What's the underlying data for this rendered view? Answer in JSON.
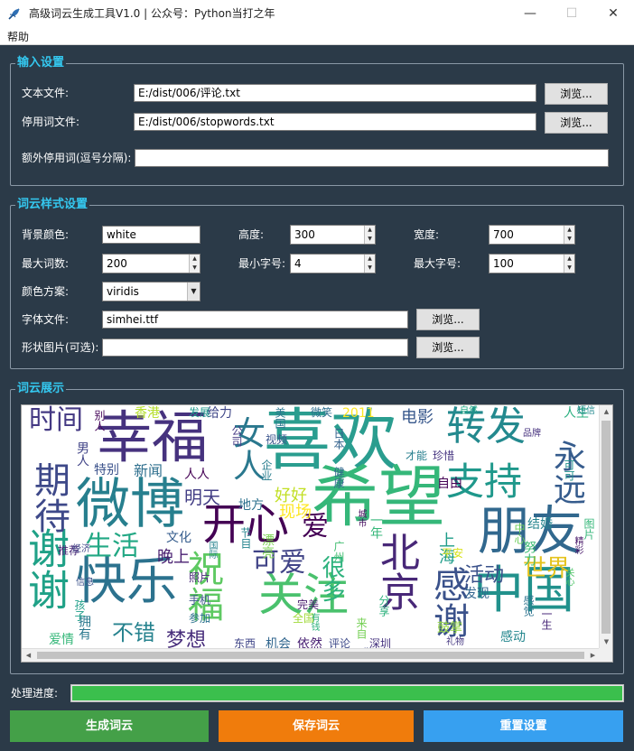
{
  "window": {
    "title": "高级词云生成工具V1.0 | 公众号：Python当打之年",
    "minimize_glyph": "—",
    "maximize_glyph": "☐",
    "close_glyph": "✕",
    "icon": "feather-icon"
  },
  "menu": {
    "help": "帮助"
  },
  "input_settings": {
    "title": "输入设置",
    "text_file_label": "文本文件:",
    "text_file_value": "E:/dist/006/评论.txt",
    "stopwords_label": "停用词文件:",
    "stopwords_value": "E:/dist/006/stopwords.txt",
    "extra_label": "额外停用词(逗号分隔):",
    "extra_value": "",
    "browse": "浏览..."
  },
  "style_settings": {
    "title": "词云样式设置",
    "bg_label": "背景颜色:",
    "bg_value": "white",
    "height_label": "高度:",
    "height_value": "300",
    "width_label": "宽度:",
    "width_value": "700",
    "max_words_label": "最大词数:",
    "max_words_value": "200",
    "min_font_label": "最小字号:",
    "min_font_value": "4",
    "max_font_label": "最大字号:",
    "max_font_value": "100",
    "colormap_label": "颜色方案:",
    "colormap_value": "viridis",
    "font_label": "字体文件:",
    "font_value": "simhei.ttf",
    "mask_label": "形状图片(可选):",
    "mask_value": "",
    "browse": "浏览..."
  },
  "display": {
    "title": "词云展示",
    "scroll_up": "▲",
    "scroll_down": "▼",
    "scroll_left": "◀",
    "scroll_right": "▶",
    "words": [
      {
        "t": "喜欢",
        "c": "#2a9d8f"
      },
      {
        "t": "希望",
        "c": "#35b779"
      },
      {
        "t": "幸福",
        "c": "#46327e"
      },
      {
        "t": "微博",
        "c": "#277f8e"
      },
      {
        "t": "朋友",
        "c": "#31688e"
      },
      {
        "t": "中国",
        "c": "#21918c"
      },
      {
        "t": "快乐",
        "c": "#2c728e"
      },
      {
        "t": "关注",
        "c": "#4ac16d"
      },
      {
        "t": "开心",
        "c": "#440154"
      },
      {
        "t": "感谢",
        "c": "#3b528b"
      },
      {
        "t": "谢谢",
        "c": "#1fa187"
      },
      {
        "t": "期待",
        "c": "#3e4989"
      },
      {
        "t": "转发",
        "c": "#23898e"
      },
      {
        "t": "支持",
        "c": "#1f988b"
      },
      {
        "t": "北京",
        "c": "#482878"
      },
      {
        "t": "永远",
        "c": "#365c8d"
      },
      {
        "t": "祝福",
        "c": "#5ec962"
      },
      {
        "t": "女人",
        "c": "#2a788e"
      },
      {
        "t": "时间",
        "c": "#443983"
      },
      {
        "t": "生活",
        "c": "#22a884"
      },
      {
        "t": "世界",
        "c": "#e5c31e"
      },
      {
        "t": "可爱",
        "c": "#414487"
      },
      {
        "t": "很多",
        "c": "#2db27d"
      },
      {
        "t": "活动",
        "c": "#3b528b"
      },
      {
        "t": "不错",
        "c": "#26828e"
      },
      {
        "t": "梦想",
        "c": "#472d7b"
      },
      {
        "t": "爱",
        "c": "#440154"
      },
      {
        "t": "好好",
        "c": "#c2df23"
      },
      {
        "t": "明天",
        "c": "#433e85"
      },
      {
        "t": "上海",
        "c": "#1e9c89"
      },
      {
        "t": "电影",
        "c": "#38588c"
      },
      {
        "t": "人生",
        "c": "#29af7f"
      },
      {
        "t": "晚上",
        "c": "#481f70"
      },
      {
        "t": "新闻",
        "c": "#2e6f8e"
      },
      {
        "t": "现场",
        "c": "#fde725"
      },
      {
        "t": "香港",
        "c": "#b5de2b"
      },
      {
        "t": "给力",
        "c": "#3f4788"
      },
      {
        "t": "地方",
        "c": "#2c718e"
      },
      {
        "t": "发现",
        "c": "#32658e"
      },
      {
        "t": "感动",
        "c": "#24878e"
      },
      {
        "t": "结婚",
        "c": "#25848e"
      },
      {
        "t": "努力",
        "c": "#3dbc74"
      },
      {
        "t": "文化",
        "c": "#365d8d"
      },
      {
        "t": "机会",
        "c": "#31668e"
      },
      {
        "t": "依然",
        "c": "#482173"
      },
      {
        "t": "评论",
        "c": "#3e4a89"
      },
      {
        "t": "深圳",
        "c": "#46337f"
      },
      {
        "t": "鼓掌",
        "c": "#95d840"
      },
      {
        "t": "特别",
        "c": "#3b528b"
      },
      {
        "t": "别人",
        "c": "#450559"
      },
      {
        "t": "爱情",
        "c": "#35b779"
      },
      {
        "t": "拥有",
        "c": "#2a788e"
      },
      {
        "t": "推荐",
        "c": "#482878"
      },
      {
        "t": "健康",
        "c": "#31688e"
      },
      {
        "t": "自由",
        "c": "#440154"
      },
      {
        "t": "珍惜",
        "c": "#463480"
      },
      {
        "t": "才能",
        "c": "#277f8e"
      },
      {
        "t": "2011",
        "c": "#fde725"
      },
      {
        "t": "照片",
        "c": "#482878"
      },
      {
        "t": "图片",
        "c": "#35b779"
      },
      {
        "t": "分享",
        "c": "#2db27d"
      },
      {
        "t": "公司",
        "c": "#443983"
      },
      {
        "t": "手机",
        "c": "#3b528b"
      },
      {
        "t": "可可",
        "c": "#21918c"
      },
      {
        "t": "男人",
        "c": "#414487"
      },
      {
        "t": "平安",
        "c": "#d8e219"
      },
      {
        "t": "中心",
        "c": "#6ccd5a"
      },
      {
        "t": "感觉",
        "c": "#2c728e"
      },
      {
        "t": "全国",
        "c": "#a0da39"
      },
      {
        "t": "企业",
        "c": "#287d8e"
      },
      {
        "t": "视频",
        "c": "#3a548c"
      },
      {
        "t": "美国",
        "c": "#2a768e"
      },
      {
        "t": "发展",
        "c": "#1f988b"
      },
      {
        "t": "完美",
        "c": "#481b6d"
      },
      {
        "t": "广州",
        "c": "#42be71"
      },
      {
        "t": "来自",
        "c": "#75d054"
      },
      {
        "t": "微笑",
        "c": "#2e6e8e"
      },
      {
        "t": "自然",
        "c": "#22a884"
      },
      {
        "t": "学习",
        "c": "#3e4989"
      },
      {
        "t": "人人",
        "c": "#440154"
      },
      {
        "t": "节目",
        "c": "#25848e"
      },
      {
        "t": "漂亮",
        "c": "#7ad151"
      },
      {
        "t": "日本",
        "c": "#33628d"
      },
      {
        "t": "东西",
        "c": "#404688"
      },
      {
        "t": "国际",
        "c": "#26828e"
      },
      {
        "t": "有钱",
        "c": "#2db27d"
      },
      {
        "t": "孩子",
        "c": "#1f9e89"
      },
      {
        "t": "经济",
        "c": "#3f4788"
      },
      {
        "t": "城市",
        "c": "#470d60"
      },
      {
        "t": "品牌",
        "c": "#46327e"
      },
      {
        "t": "礼物",
        "c": "#453781"
      },
      {
        "t": "关心",
        "c": "#50c46a"
      },
      {
        "t": "精彩",
        "c": "#48186a"
      },
      {
        "t": "短信",
        "c": "#23898e"
      },
      {
        "t": "信息",
        "c": "#3b528b"
      },
      {
        "t": "一年",
        "c": "#35b779"
      },
      {
        "t": "参加",
        "c": "#2c718e"
      },
      {
        "t": "一生",
        "c": "#482878"
      }
    ]
  },
  "progress": {
    "label": "处理进度:",
    "value": 1.0
  },
  "actions": {
    "generate": "生成词云",
    "save": "保存词云",
    "reset": "重置设置",
    "colors": {
      "generate": "#44a048",
      "save": "#f07c0c",
      "reset": "#37a0f0"
    }
  }
}
